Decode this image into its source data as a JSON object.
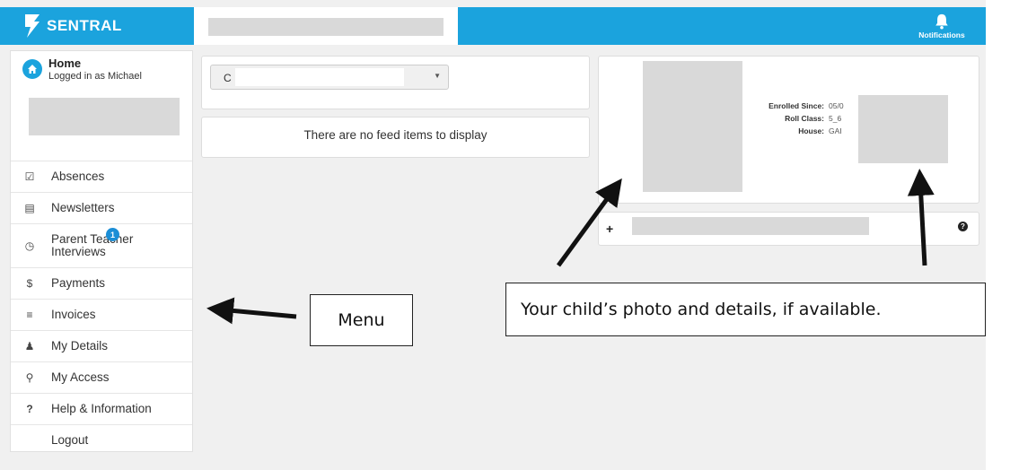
{
  "header": {
    "brand": "SENTRAL",
    "notifications_label": "Notifications",
    "brand_color": "#1ba3dd"
  },
  "sidebar": {
    "home_title": "Home",
    "home_subtitle": "Logged in as Michael",
    "items": [
      {
        "label": "Absences",
        "icon": "checkbox-icon"
      },
      {
        "label": "Newsletters",
        "icon": "newspaper-icon"
      },
      {
        "label": "Parent Teacher Interviews",
        "icon": "clock-icon",
        "badge": "1"
      },
      {
        "label": "Payments",
        "icon": "dollar-icon"
      },
      {
        "label": "Invoices",
        "icon": "list-icon"
      },
      {
        "label": "My Details",
        "icon": "user-icon"
      },
      {
        "label": "My Access",
        "icon": "key-icon"
      },
      {
        "label": "Help & Information",
        "icon": "question-icon"
      },
      {
        "label": "Logout",
        "icon": ""
      }
    ]
  },
  "main": {
    "student_select_value": "C",
    "feed_message": "There are no feed items to display"
  },
  "student_details": {
    "enrolled_since_label": "Enrolled Since:",
    "enrolled_since_value": "05/0",
    "roll_class_label": "Roll Class:",
    "roll_class_value": "5_6",
    "house_label": "House:",
    "house_value": "GAI"
  },
  "annotations": {
    "menu_callout": "Menu",
    "photo_callout": "Your child’s photo and details, if available."
  }
}
